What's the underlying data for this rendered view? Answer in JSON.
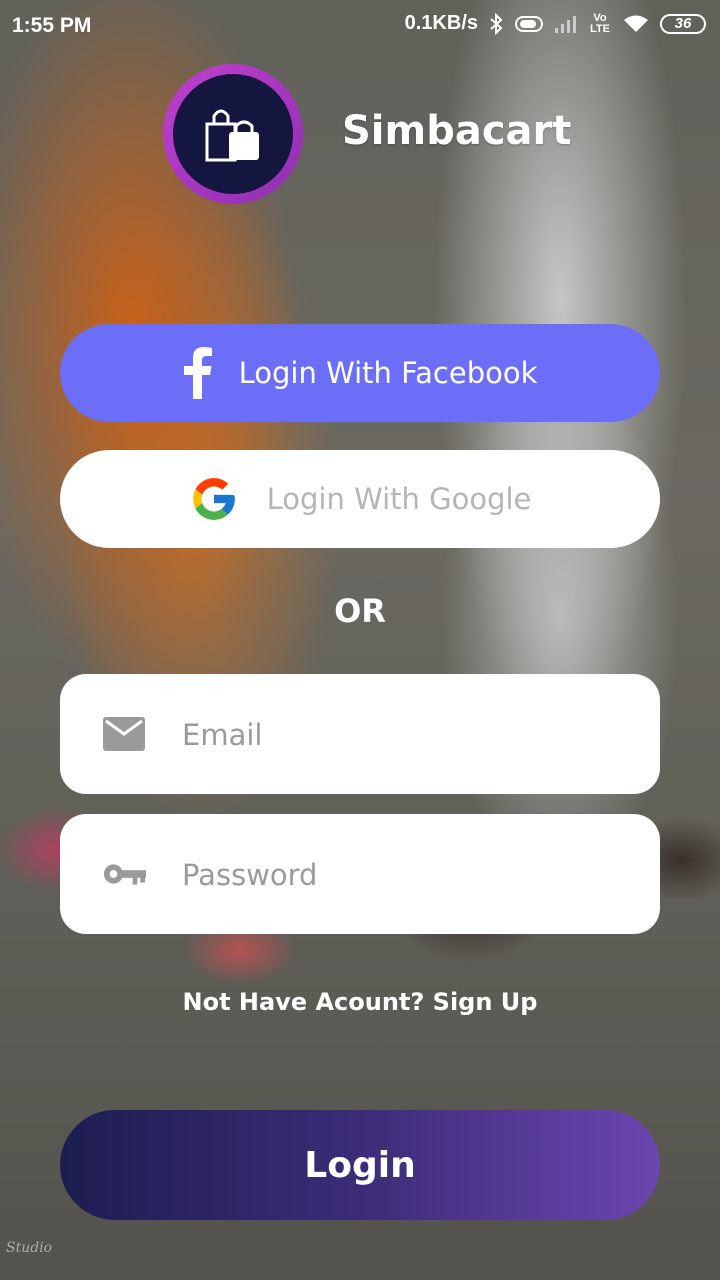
{
  "status_bar": {
    "time": "1:55 PM",
    "network_speed": "0.1KB/s",
    "volte_label": "Vo LTE",
    "battery_level": "36",
    "icons": [
      "bluetooth-icon",
      "vibrate-icon",
      "signal-icon",
      "volte-icon",
      "wifi-icon",
      "battery-icon"
    ]
  },
  "app": {
    "title": "Simbacart",
    "logo_icon": "shopping-bags-icon",
    "accent_color": "#6c6ef7",
    "logo_ring_color": "#c13fd0",
    "logo_bg_color": "#14163f"
  },
  "social": {
    "facebook_label": "Login With Facebook",
    "facebook_icon": "facebook-icon",
    "google_label": "Login With Google",
    "google_icon": "google-icon"
  },
  "divider": {
    "or_label": "OR"
  },
  "form": {
    "email": {
      "placeholder": "Email",
      "value": "",
      "icon": "mail-icon"
    },
    "password": {
      "placeholder": "Password",
      "value": "",
      "icon": "key-icon"
    }
  },
  "signup_link": "Not Have Acount? Sign Up",
  "login_button": "Login",
  "watermark": "Studio"
}
